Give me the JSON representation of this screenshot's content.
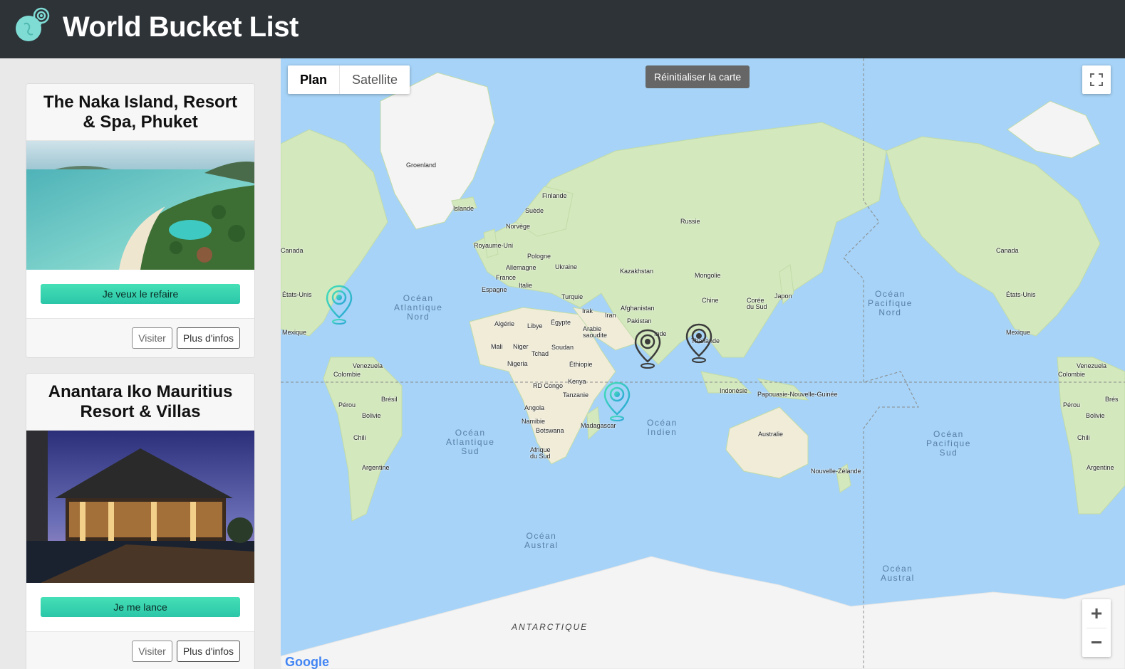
{
  "header": {
    "title": "World Bucket List",
    "logo_icon": "globe-pin-icon"
  },
  "colors": {
    "topbar": "#2e3338",
    "accent": "#2bc6a8",
    "ocean": "#a6d3f7",
    "land": "#cfe6b9"
  },
  "cards": [
    {
      "title": "The Naka Island, Resort & Spa, Phuket",
      "cta": "Je veux le refaire",
      "visit": "Visiter",
      "info": "Plus d'infos"
    },
    {
      "title": "Anantara Iko Mauritius Resort & Villas",
      "cta": "Je me lance",
      "visit": "Visiter",
      "info": "Plus d'infos"
    }
  ],
  "map": {
    "maptype": {
      "plan": "Plan",
      "satellite": "Satellite"
    },
    "reset": "Réinitialiser la carte",
    "zoom_in": "+",
    "zoom_out": "−",
    "logo": "Google",
    "labels": {
      "groenland": "Groenland",
      "islande": "Islande",
      "finlande": "Finlande",
      "suede": "Suède",
      "norvege": "Norvège",
      "russie": "Russie",
      "royaume_uni": "Royaume-Uni",
      "pologne": "Pologne",
      "allemagne": "Allemagne",
      "ukraine": "Ukraine",
      "france": "France",
      "italie": "Italie",
      "espagne": "Espagne",
      "turquie": "Turquie",
      "kazakhstan": "Kazakhstan",
      "mongolie": "Mongolie",
      "canada_left": "Canada",
      "canada_right": "Canada",
      "etats_unis_left": "États-Unis",
      "etats_unis_right": "États-Unis",
      "mexique_left": "Mexique",
      "mexique_right": "Mexique",
      "algerie": "Algérie",
      "libye": "Libye",
      "egypte": "Égypte",
      "irak": "Irak",
      "iran": "Iran",
      "afghanistan": "Afghanistan",
      "chine": "Chine",
      "coree_sud": "Corée\ndu Sud",
      "japon": "Japon",
      "pakistan": "Pakistan",
      "arabie": "Arabie\nsaoudite",
      "inde": "Inde",
      "thailande": "Thaïlande",
      "mali": "Mali",
      "niger": "Niger",
      "tchad": "Tchad",
      "soudan": "Soudan",
      "nigeria": "Nigeria",
      "ethiopie": "Éthiopie",
      "kenya": "Kenya",
      "rd_congo": "RD Congo",
      "tanzanie": "Tanzanie",
      "angola": "Angola",
      "namibie": "Namibie",
      "botswana": "Botswana",
      "madagascar": "Madagascar",
      "afrique_sud": "Afrique\ndu Sud",
      "venezuela_left": "Venezuela",
      "venezuela_right": "Venezuela",
      "colombie_left": "Colombie",
      "colombie_right": "Colombie",
      "bresil": "Brésil",
      "bres_right": "Brés",
      "perou_left": "Pérou",
      "perou_right": "Pérou",
      "bolivie_left": "Bolivie",
      "bolivie_right": "Bolivie",
      "chili_left": "Chili",
      "chili_right": "Chili",
      "argentine_left": "Argentine",
      "argentine_right": "Argentine",
      "indonesie": "Indonésie",
      "papouasie": "Papouasie-Nouvelle-Guinée",
      "australie": "Australie",
      "nz": "Nouvelle-Zélande",
      "antarctique": "ANTARCTIQUE"
    },
    "oceans": {
      "atl_nord": "Océan\nAtlantique\nNord",
      "pac_nord": "Océan\nPacifique\nNord",
      "atl_sud": "Océan\nAtlantique\nSud",
      "indien": "Océan\nIndien",
      "pac_sud": "Océan\nPacifique\nSud",
      "austral_1": "Océan\nAustral",
      "austral_2": "Océan\nAustral"
    },
    "pins": [
      {
        "name": "East coast USA",
        "state": "active"
      },
      {
        "name": "India",
        "state": "visited"
      },
      {
        "name": "Thailand",
        "state": "visited"
      },
      {
        "name": "Mauritius",
        "state": "active"
      }
    ]
  }
}
